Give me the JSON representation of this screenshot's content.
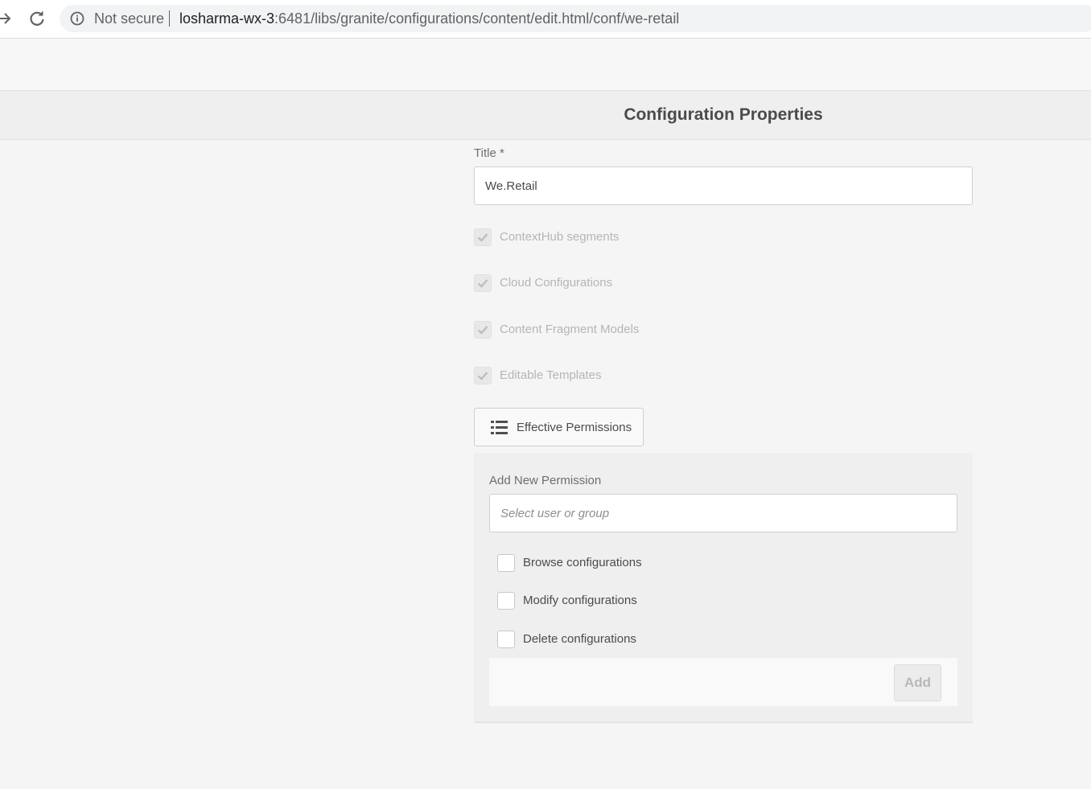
{
  "browser": {
    "security_label": "Not secure",
    "url_host": "losharma-wx-3",
    "url_rest": ":6481/libs/granite/configurations/content/edit.html/conf/we-retail"
  },
  "page": {
    "title": "Configuration Properties"
  },
  "form": {
    "title_label": "Title *",
    "title_value": "We.Retail",
    "features": [
      {
        "label": "ContextHub segments",
        "checked": true,
        "disabled": true
      },
      {
        "label": "Cloud Configurations",
        "checked": true,
        "disabled": true
      },
      {
        "label": "Content Fragment Models",
        "checked": true,
        "disabled": true
      },
      {
        "label": "Editable Templates",
        "checked": true,
        "disabled": true
      }
    ],
    "effective_permissions_label": "Effective Permissions",
    "permissions": {
      "add_label": "Add New Permission",
      "user_placeholder": "Select user or group",
      "options": [
        {
          "label": "Browse configurations",
          "checked": false
        },
        {
          "label": "Modify configurations",
          "checked": false
        },
        {
          "label": "Delete configurations",
          "checked": false
        }
      ],
      "add_button": "Add"
    }
  },
  "colors": {
    "page_bg": "#f5f5f5",
    "disabled_text": "#b5b5b5",
    "text": "#4b4b4b"
  }
}
